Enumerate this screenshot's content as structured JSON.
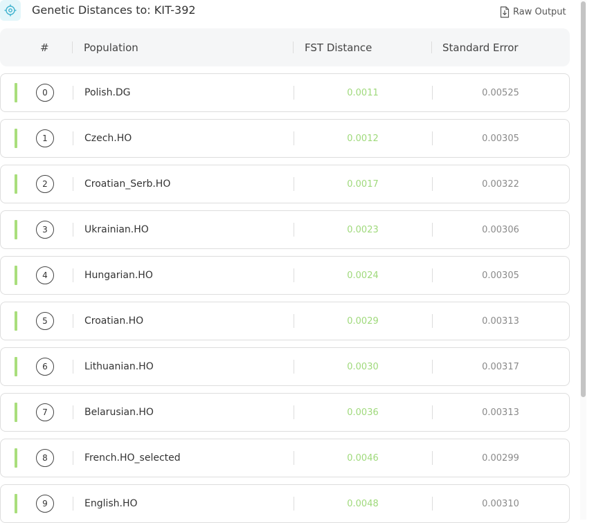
{
  "header": {
    "title": "Genetic Distances to: KIT-392",
    "title_icon": "target-icon",
    "raw_output_label": "Raw Output",
    "raw_output_icon": "download-file-icon"
  },
  "table": {
    "columns": [
      "#",
      "Population",
      "FST Distance",
      "Standard Error"
    ],
    "rows": [
      {
        "rank": "0",
        "population": "Polish.DG",
        "fst": "0.0011",
        "se": "0.00525"
      },
      {
        "rank": "1",
        "population": "Czech.HO",
        "fst": "0.0012",
        "se": "0.00305"
      },
      {
        "rank": "2",
        "population": "Croatian_Serb.HO",
        "fst": "0.0017",
        "se": "0.00322"
      },
      {
        "rank": "3",
        "population": "Ukrainian.HO",
        "fst": "0.0023",
        "se": "0.00306"
      },
      {
        "rank": "4",
        "population": "Hungarian.HO",
        "fst": "0.0024",
        "se": "0.00305"
      },
      {
        "rank": "5",
        "population": "Croatian.HO",
        "fst": "0.0029",
        "se": "0.00313"
      },
      {
        "rank": "6",
        "population": "Lithuanian.HO",
        "fst": "0.0030",
        "se": "0.00317"
      },
      {
        "rank": "7",
        "population": "Belarusian.HO",
        "fst": "0.0036",
        "se": "0.00313"
      },
      {
        "rank": "8",
        "population": "French.HO_selected",
        "fst": "0.0046",
        "se": "0.00299"
      },
      {
        "rank": "9",
        "population": "English.HO",
        "fst": "0.0048",
        "se": "0.00310"
      }
    ]
  },
  "colors": {
    "accent_green": "#a9de7c",
    "fst_text": "#9fd97b",
    "icon_teal": "#3fb3cf",
    "header_bg": "#f5f6f7"
  }
}
